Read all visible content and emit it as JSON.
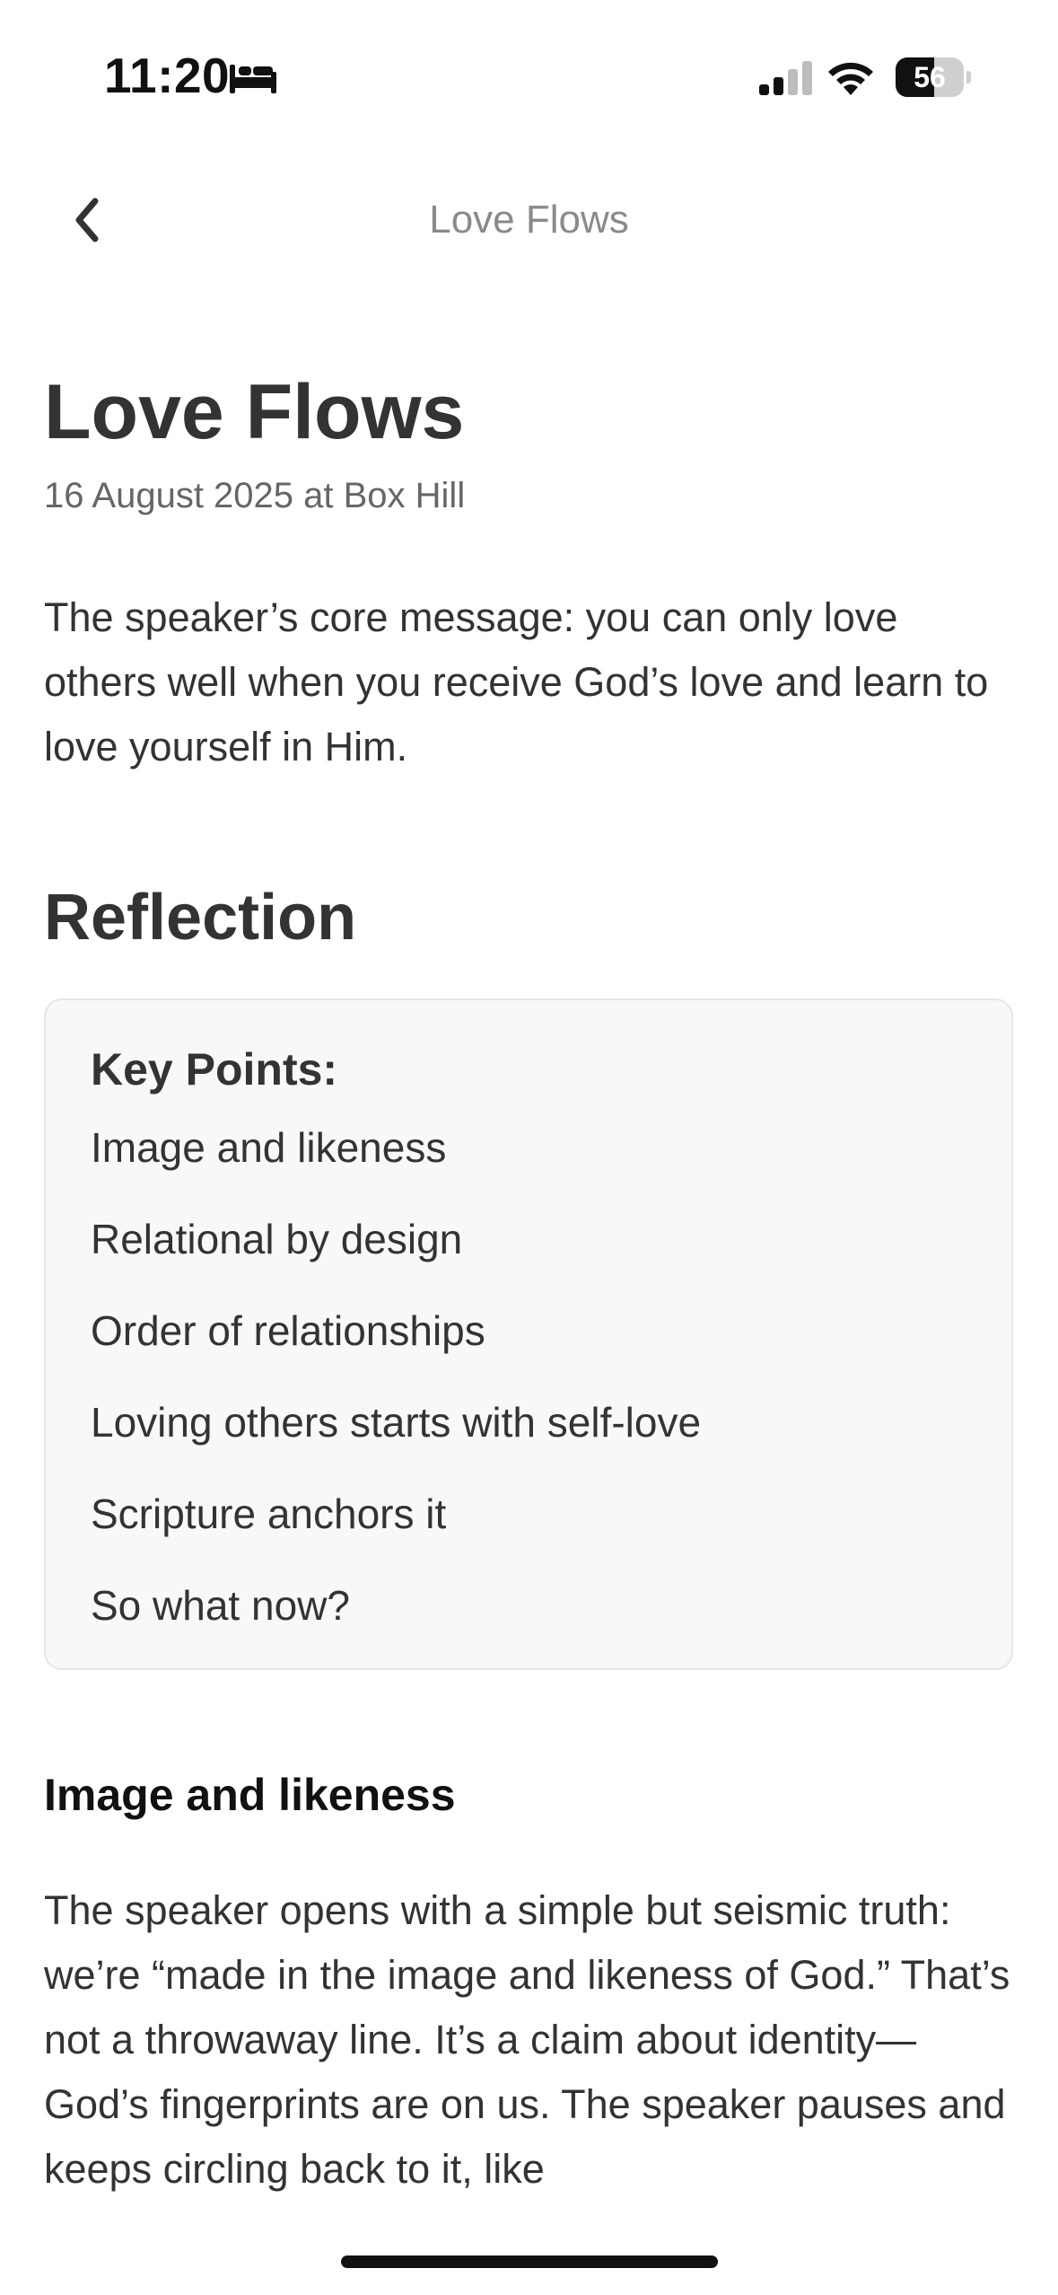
{
  "status_bar": {
    "time": "11:20",
    "sleep_icon": "bed-icon",
    "signal_icon": "cellular-signal-icon",
    "wifi_icon": "wifi-icon",
    "battery_level": "56",
    "battery_fraction": 0.56
  },
  "nav": {
    "back_icon": "chevron-left-icon",
    "title": "Love Flows"
  },
  "article": {
    "title": "Love Flows",
    "meta": "16 August 2025 at Box Hill",
    "summary": "The speaker’s core message: you can only love others well when you receive God’s love and learn to love yourself in Him.",
    "section_heading": "Reflection",
    "key_points": {
      "title": "Key Points:",
      "items": [
        "Image and likeness",
        "Relational by design",
        "Order of relationships",
        "Loving others starts with self-love",
        "Scripture anchors it",
        "So what now?"
      ]
    },
    "subsection": {
      "heading": "Image and likeness",
      "body": "The speaker opens with a simple but seismic truth: we’re “made in the image and likeness of God.” That’s not a throwaway line. It’s a claim about identity—God’s fingerprints are on us. The speaker pauses and keeps circling back to it, like"
    }
  },
  "colors": {
    "text": "#333333",
    "muted": "#666666",
    "nav_title": "#8a8a8a",
    "box_background": "#f8f8f8",
    "box_border": "#e6e6e6"
  }
}
